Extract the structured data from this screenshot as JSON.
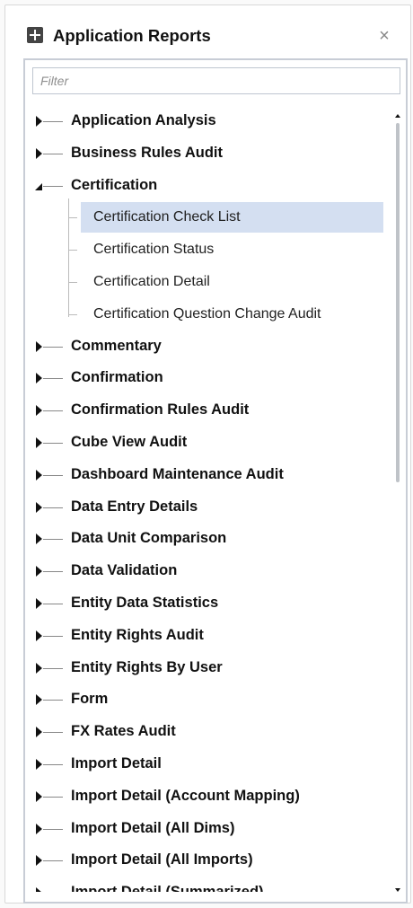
{
  "header": {
    "title": "Application Reports",
    "app_icon": "grid-plus-icon",
    "close_label": "×"
  },
  "filter": {
    "placeholder": "Filter",
    "value": ""
  },
  "tree": {
    "items": [
      {
        "label": "Application Analysis",
        "expanded": false
      },
      {
        "label": "Business Rules Audit",
        "expanded": false
      },
      {
        "label": "Certification",
        "expanded": true,
        "children": [
          {
            "label": "Certification Check List",
            "selected": true
          },
          {
            "label": "Certification Status",
            "selected": false
          },
          {
            "label": "Certification Detail",
            "selected": false
          },
          {
            "label": "Certification Question Change Audit",
            "selected": false
          }
        ]
      },
      {
        "label": "Commentary",
        "expanded": false
      },
      {
        "label": "Confirmation",
        "expanded": false
      },
      {
        "label": "Confirmation Rules Audit",
        "expanded": false
      },
      {
        "label": "Cube View Audit",
        "expanded": false
      },
      {
        "label": "Dashboard Maintenance Audit",
        "expanded": false
      },
      {
        "label": "Data Entry Details",
        "expanded": false
      },
      {
        "label": "Data Unit Comparison",
        "expanded": false
      },
      {
        "label": "Data Validation",
        "expanded": false
      },
      {
        "label": "Entity Data Statistics",
        "expanded": false
      },
      {
        "label": "Entity Rights Audit",
        "expanded": false
      },
      {
        "label": "Entity Rights By User",
        "expanded": false
      },
      {
        "label": "Form",
        "expanded": false
      },
      {
        "label": "FX Rates Audit",
        "expanded": false
      },
      {
        "label": "Import Detail",
        "expanded": false
      },
      {
        "label": "Import Detail (Account Mapping)",
        "expanded": false
      },
      {
        "label": "Import Detail (All Dims)",
        "expanded": false
      },
      {
        "label": "Import Detail (All Imports)",
        "expanded": false
      },
      {
        "label": "Import Detail (Summarized)",
        "expanded": false
      }
    ]
  },
  "colors": {
    "selected_bg": "#d4dff1",
    "border": "#c8cdd6"
  }
}
